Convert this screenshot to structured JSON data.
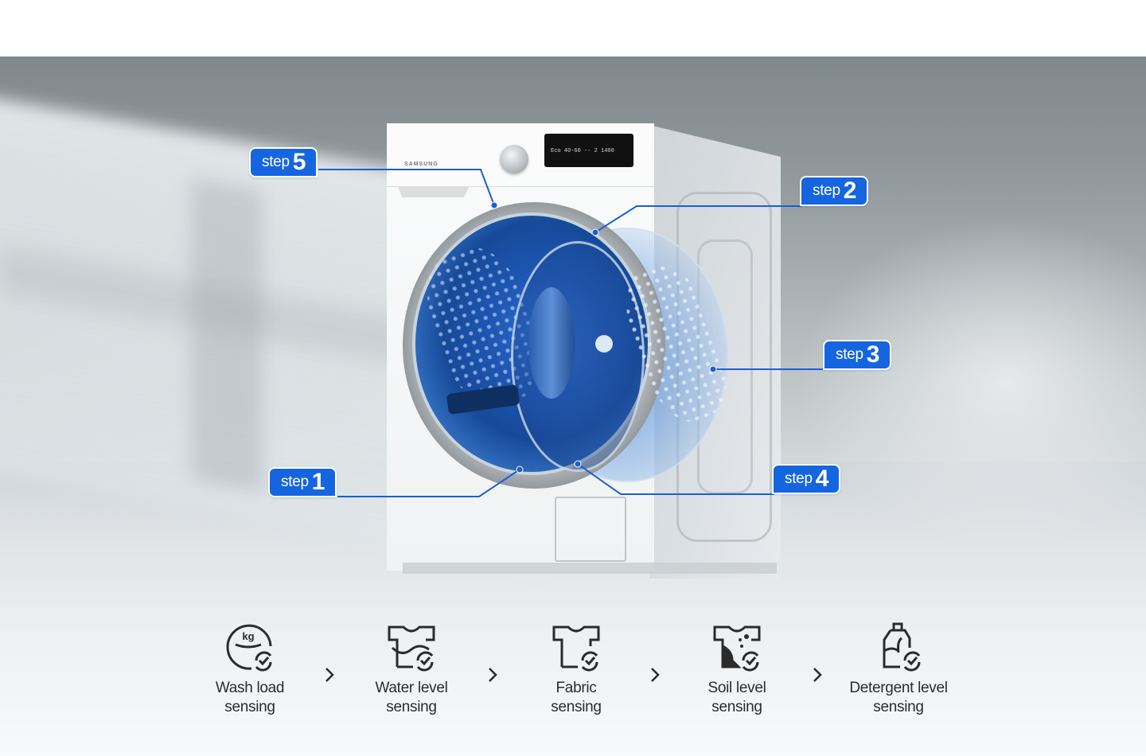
{
  "hero": {
    "brand": "SAMSUNG",
    "display_readout": "Eco 40-60   --   2  1400"
  },
  "steps": [
    {
      "id": "step-1",
      "word": "step",
      "number": "1"
    },
    {
      "id": "step-2",
      "word": "step",
      "number": "2"
    },
    {
      "id": "step-3",
      "word": "step",
      "number": "3"
    },
    {
      "id": "step-4",
      "word": "step",
      "number": "4"
    },
    {
      "id": "step-5",
      "word": "step",
      "number": "5"
    }
  ],
  "features": [
    {
      "icon": "wash-load-kg-icon",
      "line1": "Wash load",
      "line2": "sensing"
    },
    {
      "icon": "water-level-shirt-icon",
      "line1": "Water level",
      "line2": "sensing"
    },
    {
      "icon": "fabric-shirt-icon",
      "line1": "Fabric",
      "line2": "sensing"
    },
    {
      "icon": "soil-level-shirt-icon",
      "line1": "Soil level",
      "line2": "sensing"
    },
    {
      "icon": "detergent-bottle-icon",
      "line1": "Detergent level",
      "line2": "sensing"
    }
  ],
  "colors": {
    "step_badge": "#1565e0",
    "leader_line": "#1a5fd6",
    "icon_stroke": "#2b2b2b"
  }
}
